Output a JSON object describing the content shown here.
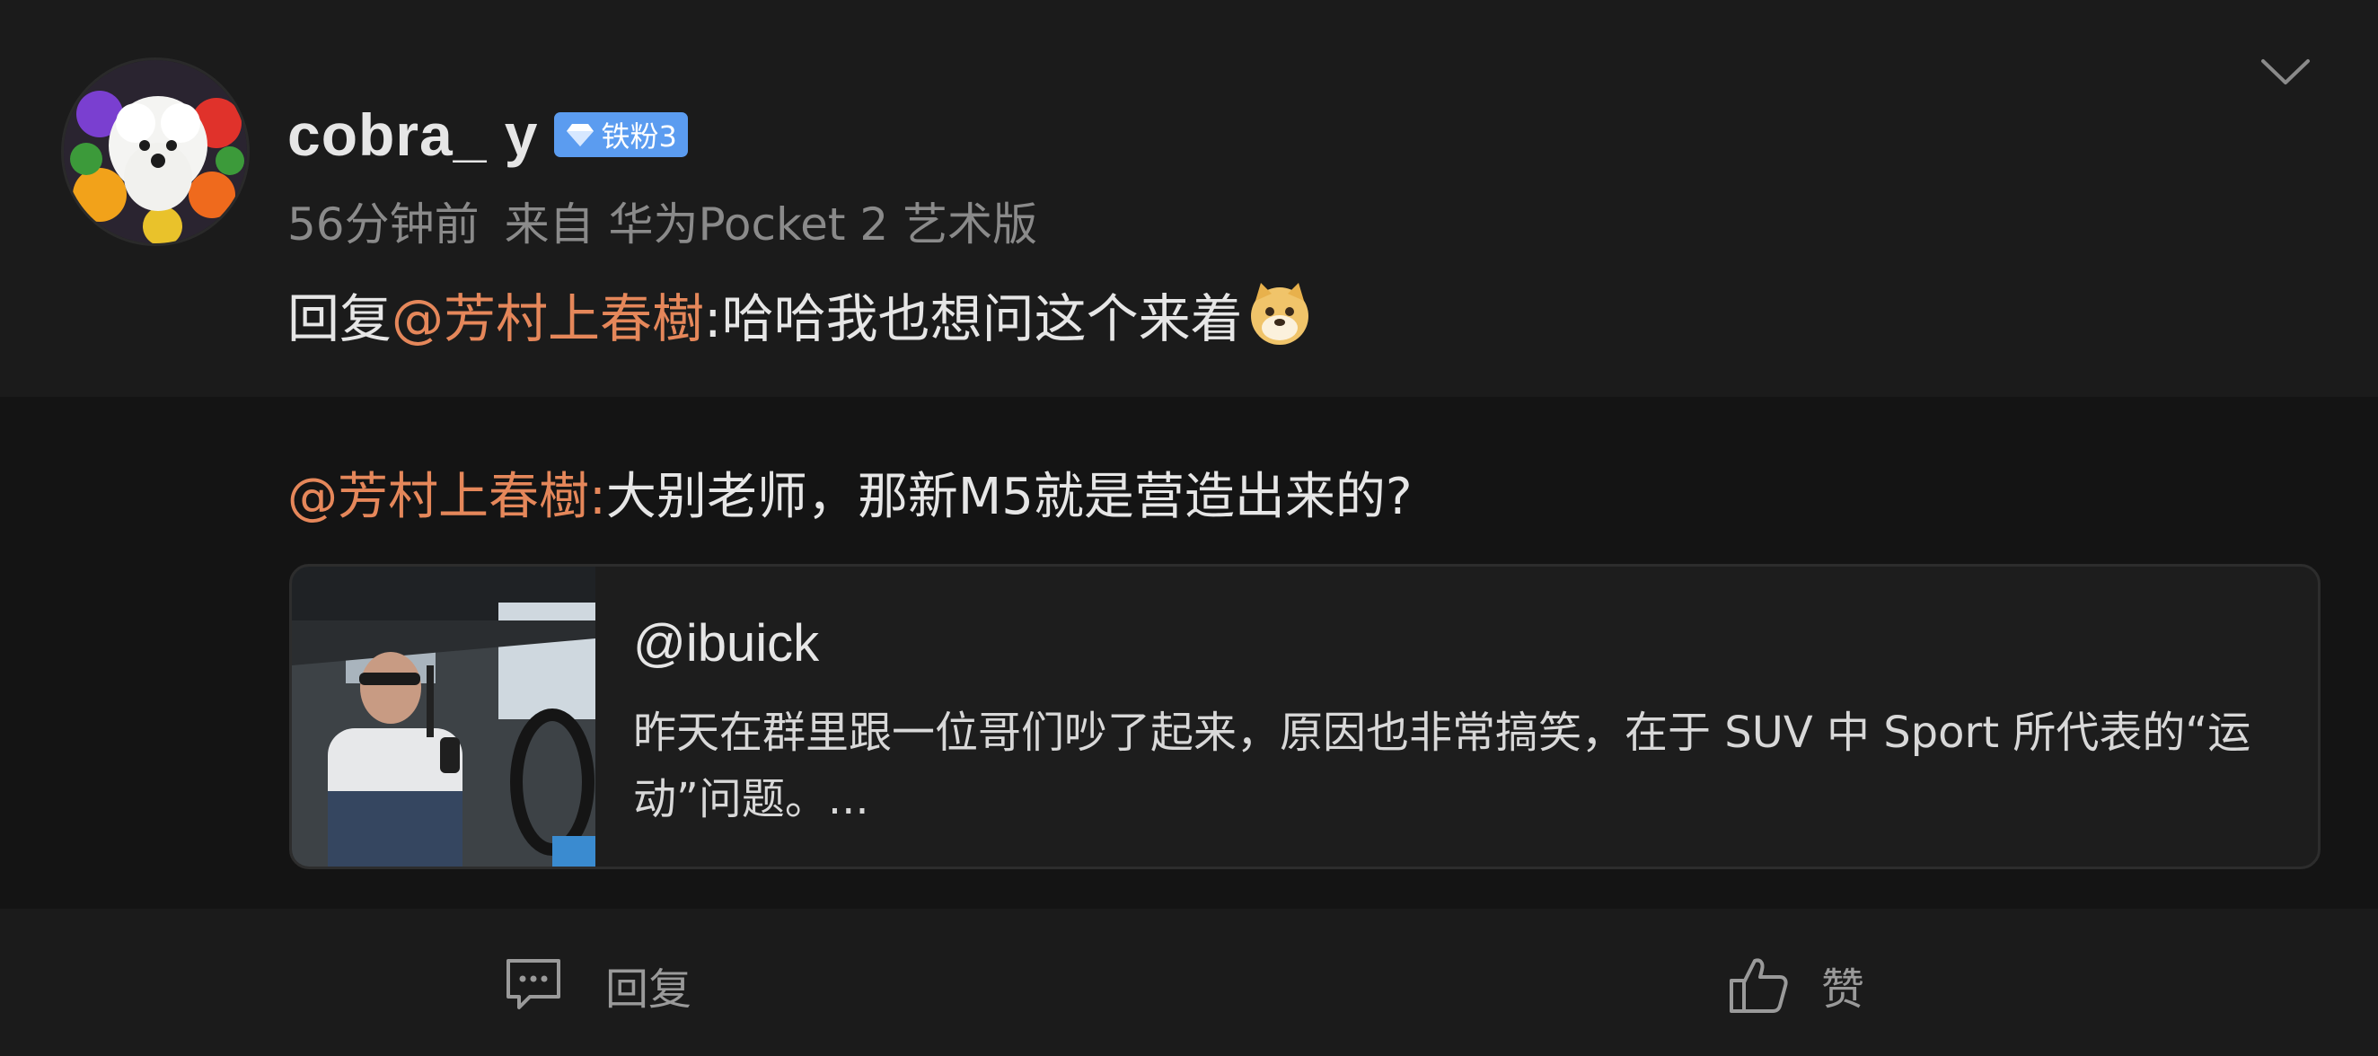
{
  "comment": {
    "username": "cobra_      y",
    "badge": "铁粉3",
    "time": "56分钟前",
    "source": "来自 华为Pocket 2 艺术版",
    "reply_prefix": "回复",
    "reply_mention": "@芳村上春樹",
    "reply_body": ":哈哈我也想问这个来着",
    "emoji": "doge-emoji"
  },
  "quoted": {
    "mention": "@芳村上春樹:",
    "text": "大别老师，那新M5就是营造出来的?",
    "card": {
      "title": "@ibuick",
      "body": "昨天在群里跟一位哥们吵了起来，原因也非常搞笑，在于 SUV 中 Sport 所代表的“运动”问题。..."
    }
  },
  "actions": {
    "reply_label": "回复",
    "like_label": "赞"
  },
  "icons": [
    "chevron-down-icon",
    "diamond-icon",
    "comment-icon",
    "thumbs-up-icon"
  ],
  "colors": {
    "mention": "#e5875a",
    "badge": "#5b9cf0",
    "background": "#1b1b1b",
    "quoted_background": "#141414"
  }
}
